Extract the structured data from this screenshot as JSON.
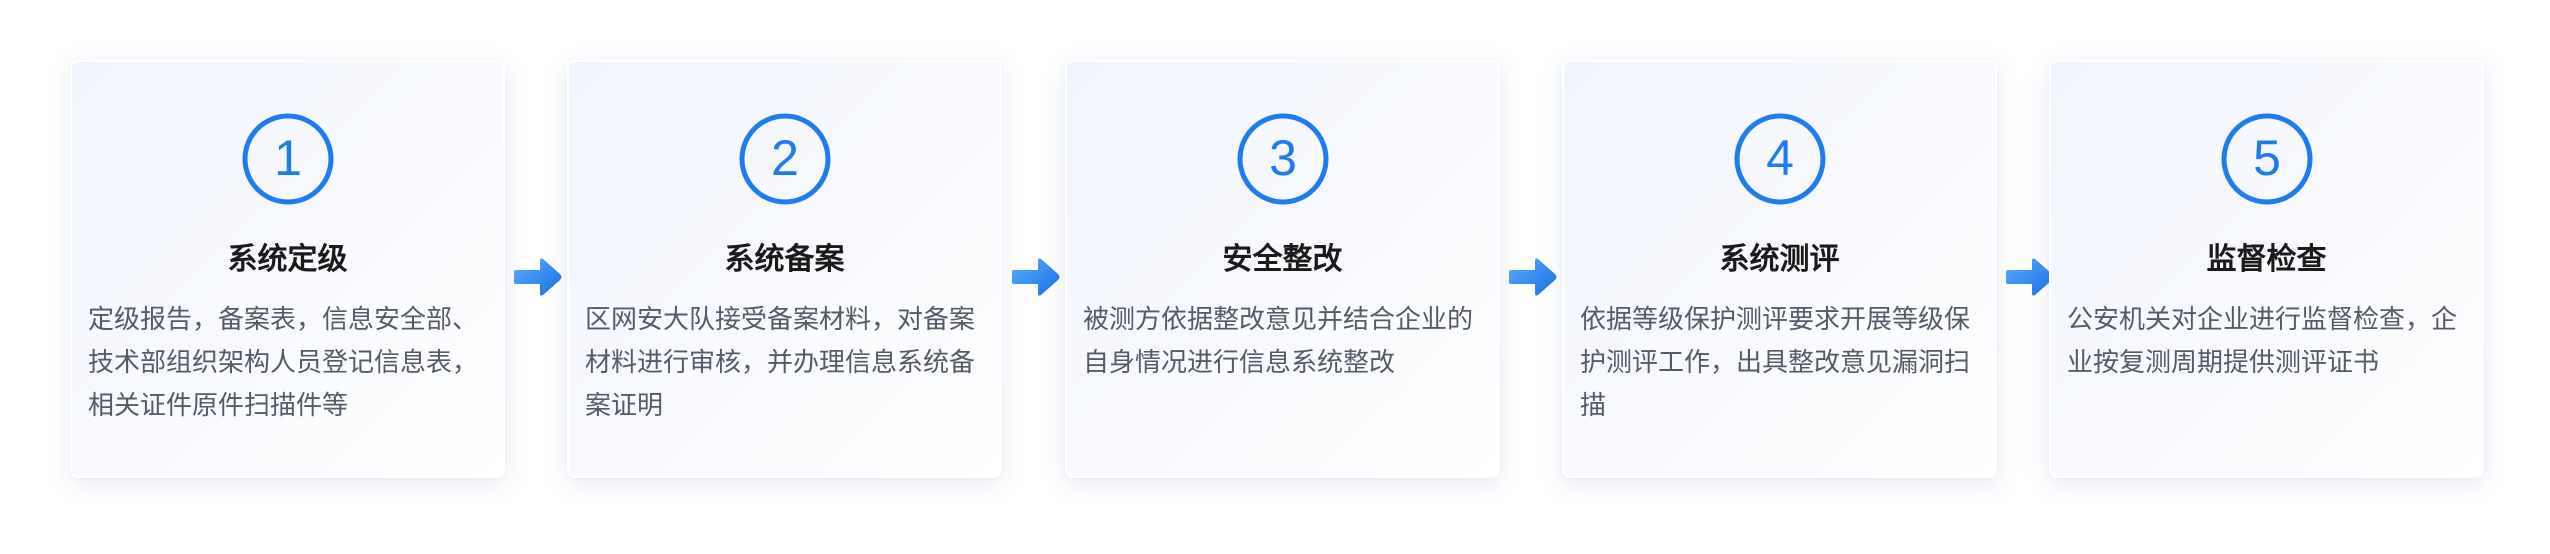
{
  "steps": [
    {
      "number": "1",
      "title": "系统定级",
      "description": "定级报告，备案表，信息安全部、技术部组织架构人员登记信息表，相关证件原件扫描件等"
    },
    {
      "number": "2",
      "title": "系统备案",
      "description": "区网安大队接受备案材料，对备案材料进行审核，并办理信息系统备案证明"
    },
    {
      "number": "3",
      "title": "安全整改",
      "description": "被测方依据整改意见并结合企业的自身情况进行信息系统整改"
    },
    {
      "number": "4",
      "title": "系统测评",
      "description": "依据等级保护测评要求开展等级保护测评工作，出具整改意见漏洞扫描"
    },
    {
      "number": "5",
      "title": "监督检查",
      "description": "公安机关对企业进行监督检查，企业按复测周期提供测评证书"
    }
  ],
  "colors": {
    "accent": "#1f7cf0",
    "arrow_start": "#3a96f7",
    "arrow_end": "#1a6fe6",
    "title": "#1a1a1a",
    "description": "#555a66"
  }
}
